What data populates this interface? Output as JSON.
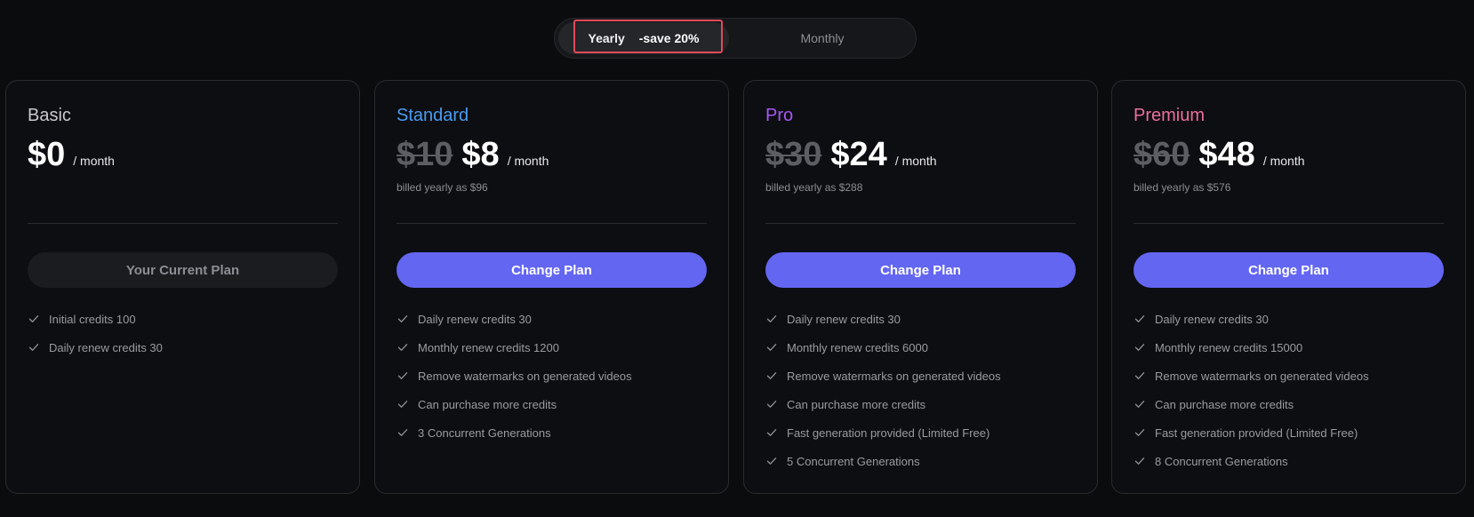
{
  "toggle": {
    "yearly_label": "Yearly",
    "save_label": "-save 20%",
    "monthly_label": "Monthly"
  },
  "colors": {
    "accent": "#6366f1",
    "standard": "#4a9bf0",
    "pro": "#a855f7",
    "premium": "#ec6f9c",
    "basic": "#c9c9cc"
  },
  "plans": [
    {
      "name": "Basic",
      "old_price": "",
      "price": "$0",
      "per": "/ month",
      "billed": "",
      "cta": "Your Current Plan",
      "features": [
        "Initial credits 100",
        "Daily renew credits 30"
      ]
    },
    {
      "name": "Standard",
      "old_price": "$10",
      "price": "$8",
      "per": "/ month",
      "billed": "billed yearly as $96",
      "cta": "Change Plan",
      "features": [
        "Daily renew credits 30",
        "Monthly renew credits 1200",
        "Remove watermarks on generated videos",
        "Can purchase more credits",
        "3 Concurrent Generations"
      ]
    },
    {
      "name": "Pro",
      "old_price": "$30",
      "price": "$24",
      "per": "/ month",
      "billed": "billed yearly as $288",
      "cta": "Change Plan",
      "features": [
        "Daily renew credits 30",
        "Monthly renew credits 6000",
        "Remove watermarks on generated videos",
        "Can purchase more credits",
        "Fast generation provided (Limited Free)",
        "5 Concurrent Generations"
      ]
    },
    {
      "name": "Premium",
      "old_price": "$60",
      "price": "$48",
      "per": "/ month",
      "billed": "billed yearly as $576",
      "cta": "Change Plan",
      "features": [
        "Daily renew credits 30",
        "Monthly renew credits 15000",
        "Remove watermarks on generated videos",
        "Can purchase more credits",
        "Fast generation provided (Limited Free)",
        "8 Concurrent Generations"
      ]
    }
  ]
}
